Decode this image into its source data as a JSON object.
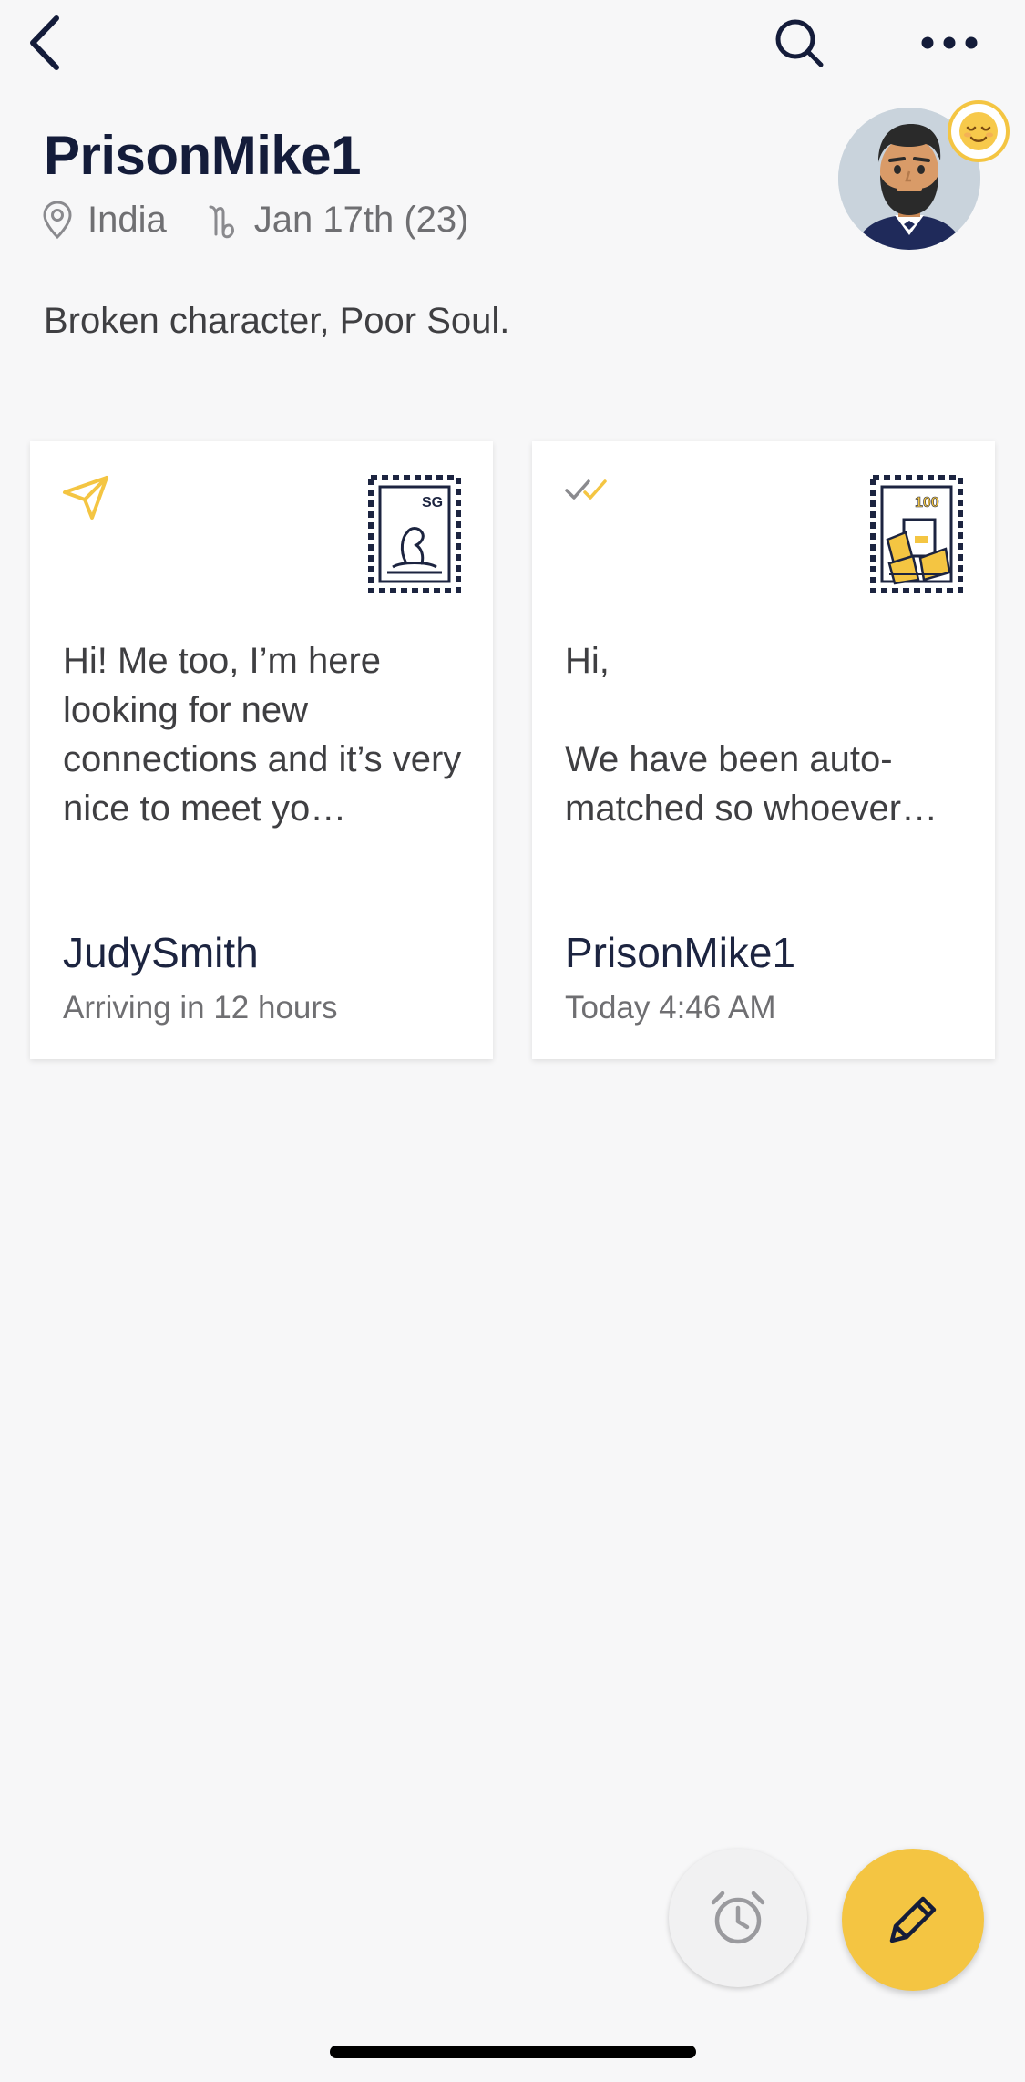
{
  "topbar": {
    "back_icon": "chevron-left-icon",
    "search_icon": "search-icon",
    "more_icon": "ellipsis-horizontal-icon"
  },
  "profile": {
    "username": "PrisonMike1",
    "location": "India",
    "birthday": "Jan 17th (23)",
    "bio": "Broken character, Poor Soul.",
    "mood_icon": "relieved-face-emoji-icon",
    "avatar_icon": "bearded-man-avatar-icon"
  },
  "letters": [
    {
      "status_icon": "paper-plane-sent-icon",
      "stamp_icon": "sg-merlion-stamp-icon",
      "stamp_label": "SG",
      "preview": "Hi! Me too, I’m here looking for new connections and it’s very nice to meet yo…",
      "sender": "JudySmith",
      "time": "Arriving in 12 hours"
    },
    {
      "status_icon": "double-check-delivered-icon",
      "stamp_icon": "100-letters-stamp-icon",
      "stamp_label": "100",
      "preview": "Hi,\n\nWe have been auto-matched so whoever…",
      "sender": "PrisonMike1",
      "time": "Today 4:46 AM"
    }
  ],
  "fabs": {
    "alarm_icon": "alarm-clock-icon",
    "compose_icon": "pencil-icon"
  },
  "colors": {
    "background": "#f7f7f8",
    "navy": "#141c3a",
    "accent_yellow": "#f4c542",
    "muted_text": "#6f6f72"
  }
}
